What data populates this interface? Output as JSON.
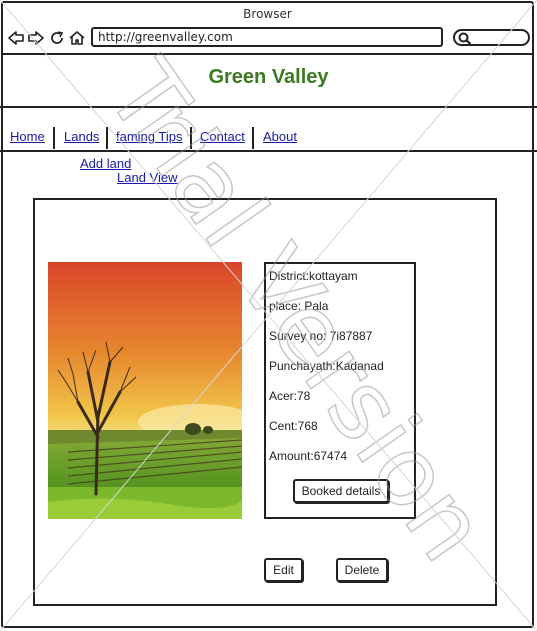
{
  "browser": {
    "window_title": "Browser",
    "url": "http://greenvalley.com"
  },
  "site": {
    "title": "Green Valley",
    "title_color": "#3a7a20"
  },
  "nav": {
    "items": [
      {
        "label": "Home"
      },
      {
        "label": "Lands"
      },
      {
        "label": "faming Tips"
      },
      {
        "label": "Contact"
      },
      {
        "label": "About"
      }
    ],
    "link_color": "#1a1aa6"
  },
  "sublinks": {
    "add_land": "Add land",
    "land_view": "Land View"
  },
  "land": {
    "image_icon": "landscape-photo",
    "district": "District:kottayam",
    "place": "place: Pala",
    "survey": "Survey no: 7i87887",
    "panchayath": "Punchayath:Kadanad",
    "acer": "Acer:78",
    "cent": "Cent:768",
    "amount": "Amount:67474",
    "booked_button": "Booked details"
  },
  "actions": {
    "edit": "Edit",
    "delete": "Delete"
  },
  "watermark": {
    "text": "Trial Version"
  }
}
